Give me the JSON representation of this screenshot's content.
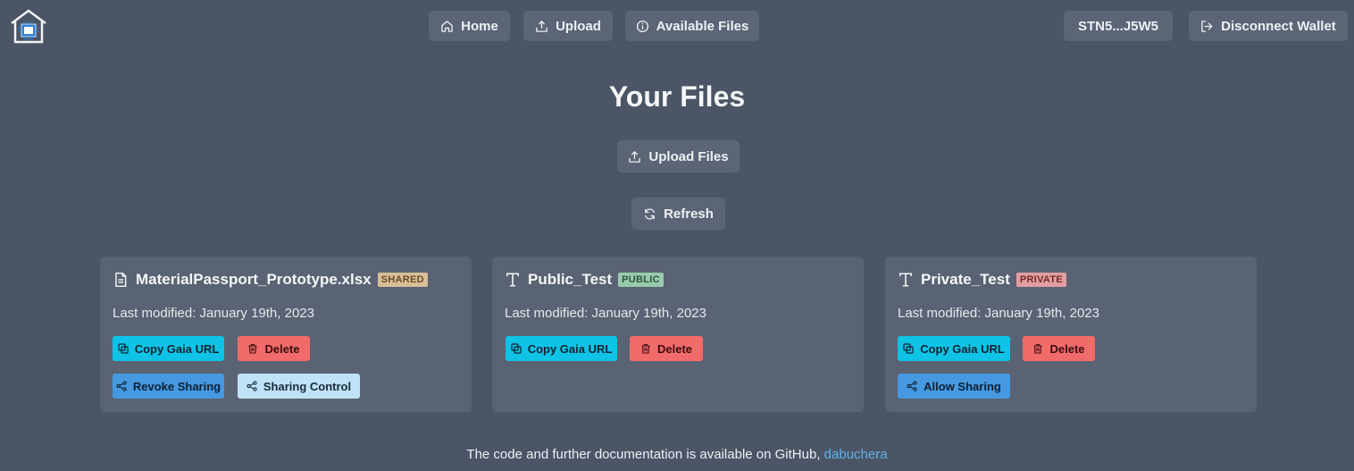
{
  "nav": {
    "home_label": "Home",
    "upload_label": "Upload",
    "available_label": "Available Files",
    "wallet_address": "STN5...J5W5",
    "disconnect_label": "Disconnect Wallet"
  },
  "main": {
    "title": "Your Files",
    "upload_files_label": "Upload Files",
    "refresh_label": "Refresh"
  },
  "files": [
    {
      "name": "MaterialPassport_Prototype.xlsx",
      "badge": "SHARED",
      "modified": "Last modified: January 19th, 2023",
      "copy_label": "Copy Gaia URL",
      "delete_label": "Delete",
      "share_label": "Revoke Sharing",
      "sharing_control_label": "Sharing Control"
    },
    {
      "name": "Public_Test",
      "badge": "PUBLIC",
      "modified": "Last modified: January 19th, 2023",
      "copy_label": "Copy Gaia URL",
      "delete_label": "Delete"
    },
    {
      "name": "Private_Test",
      "badge": "PRIVATE",
      "modified": "Last modified: January 19th, 2023",
      "copy_label": "Copy Gaia URL",
      "delete_label": "Delete",
      "share_label": "Allow Sharing"
    }
  ],
  "footer": {
    "text": "The code and further documentation is available on GitHub, ",
    "link_text": "dabuchera"
  },
  "colors": {
    "background": "#4b5566",
    "button": "#5c6576",
    "card": "#5a6373",
    "copy": "#0fc3e6",
    "delete": "#f26b6b",
    "share": "#4699e0",
    "link": "#63b3ed"
  }
}
